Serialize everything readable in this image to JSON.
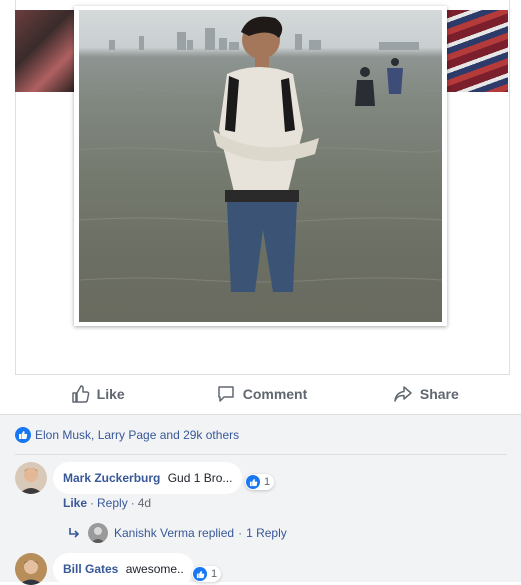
{
  "post": {
    "actions": {
      "like": "Like",
      "comment": "Comment",
      "share": "Share"
    }
  },
  "reactions": {
    "summary": "Elon Musk, Larry Page and 29k others"
  },
  "comments": [
    {
      "author": "Mark Zuckerburg",
      "text": "Gud 1 Bro...",
      "reaction_count": "1",
      "like_label": "Like",
      "reply_label": "Reply",
      "age": "4d",
      "replies_preview": {
        "text": "Kanishk Verma replied",
        "count_label": "1 Reply"
      }
    },
    {
      "author": "Bill Gates",
      "text": "awesome..",
      "reaction_count": "1"
    }
  ],
  "colors": {
    "link_blue": "#385898",
    "like_blue": "#1877f2",
    "muted": "#606770",
    "comment_bg": "#f2f3f5"
  }
}
